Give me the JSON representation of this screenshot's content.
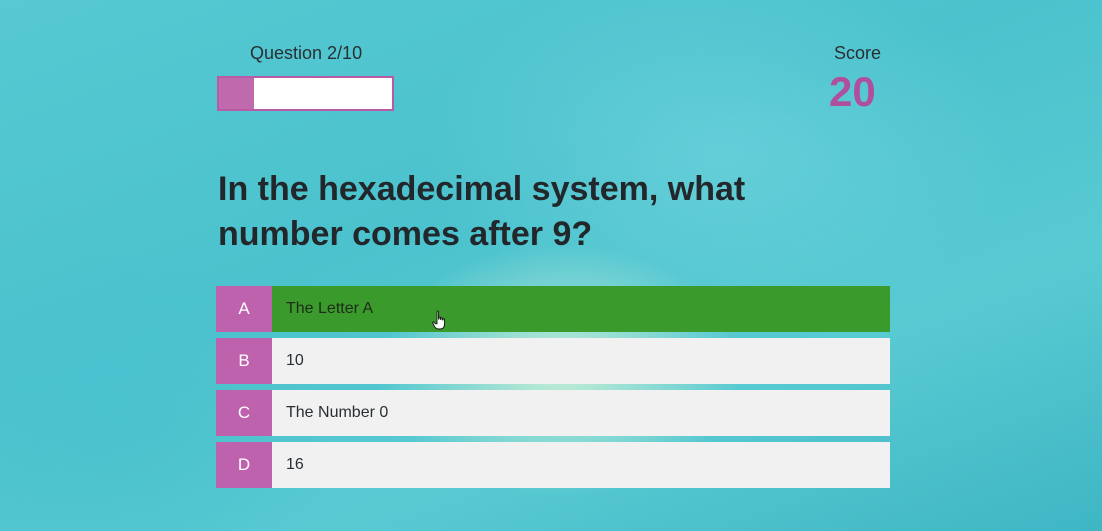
{
  "header": {
    "question_counter": "Question 2/10",
    "score_label": "Score",
    "score_value": "20"
  },
  "progress": {
    "current": 2,
    "total": 10,
    "fraction": 0.2,
    "fill_color": "#c06aae",
    "border_color": "#b85aa6"
  },
  "question": {
    "text": "In the hexadecimal system, what number comes after 9?"
  },
  "answers": [
    {
      "letter": "A",
      "text": "The Letter A",
      "state": "correct"
    },
    {
      "letter": "B",
      "text": "10",
      "state": "default"
    },
    {
      "letter": "C",
      "text": "The Number 0",
      "state": "default"
    },
    {
      "letter": "D",
      "text": "16",
      "state": "default"
    }
  ],
  "colors": {
    "accent": "#bf62ad",
    "correct": "#3a9b2c",
    "score": "#b0509c",
    "answer_bg": "#f1f1f1"
  },
  "icons": {
    "cursor": "hand-pointer-icon"
  }
}
